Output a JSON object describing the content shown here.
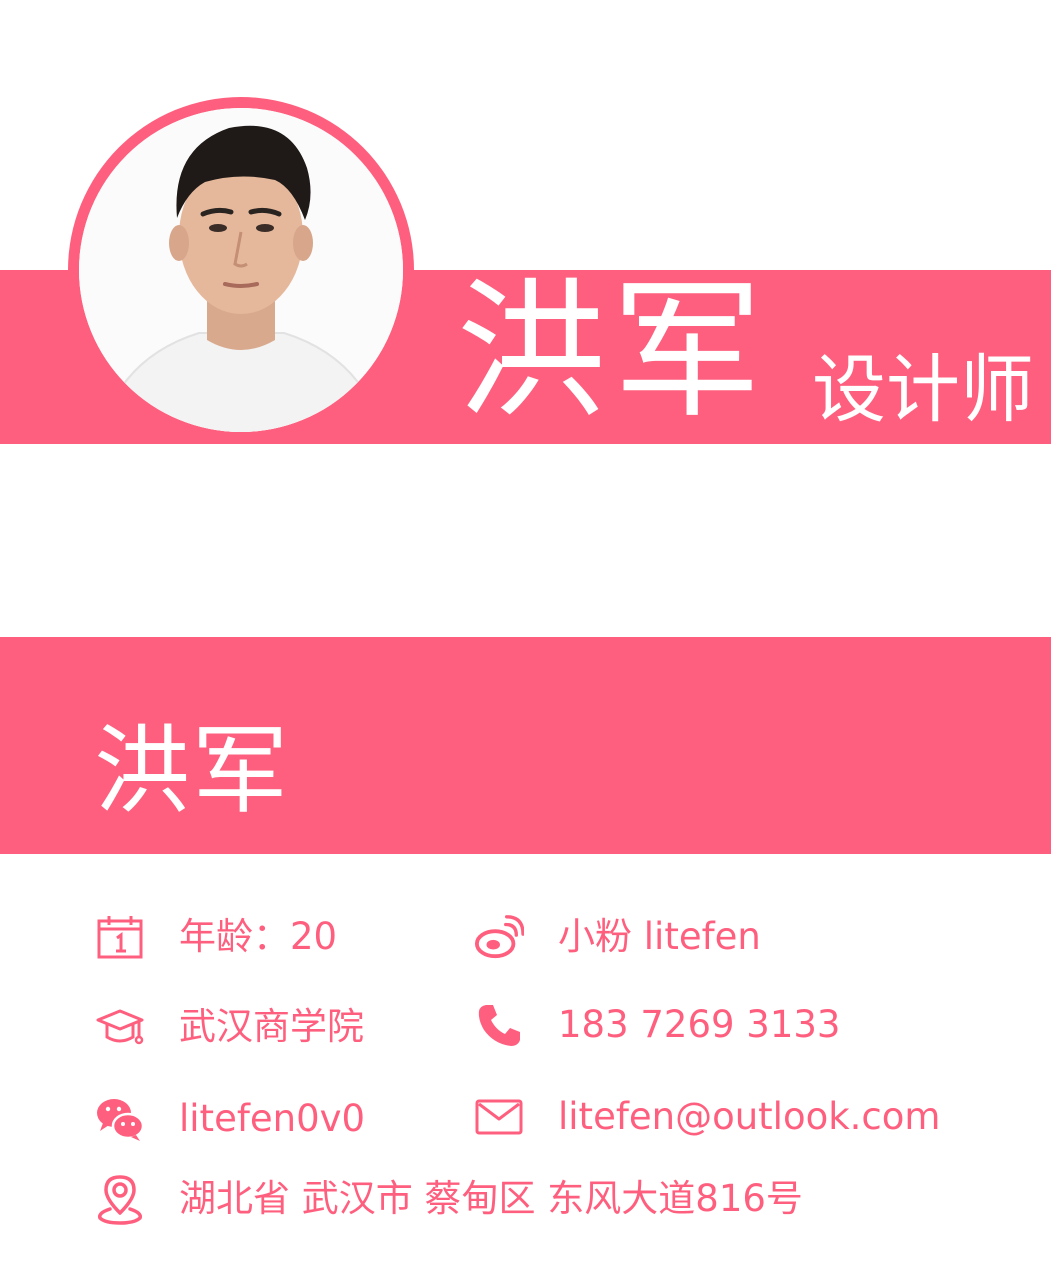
{
  "header": {
    "name": "洪军",
    "role": "设计师"
  },
  "section": {
    "name": "洪军"
  },
  "info": {
    "age": "年龄：20",
    "weibo": "小粉 litefen",
    "school": "武汉商学院",
    "phone": "183 7269 3133",
    "wechat": "litefen0v0",
    "email": "litefen@outlook.com",
    "address": "湖北省 武汉市 蔡甸区 东风大道816号"
  },
  "icons": {
    "age": "calendar-icon",
    "weibo": "weibo-icon",
    "school": "graduation-cap-icon",
    "phone": "phone-icon",
    "wechat": "wechat-icon",
    "email": "envelope-icon",
    "address": "location-pin-icon"
  },
  "colors": {
    "accent": "#ff5f7e",
    "text_on_accent": "#ffffff"
  }
}
